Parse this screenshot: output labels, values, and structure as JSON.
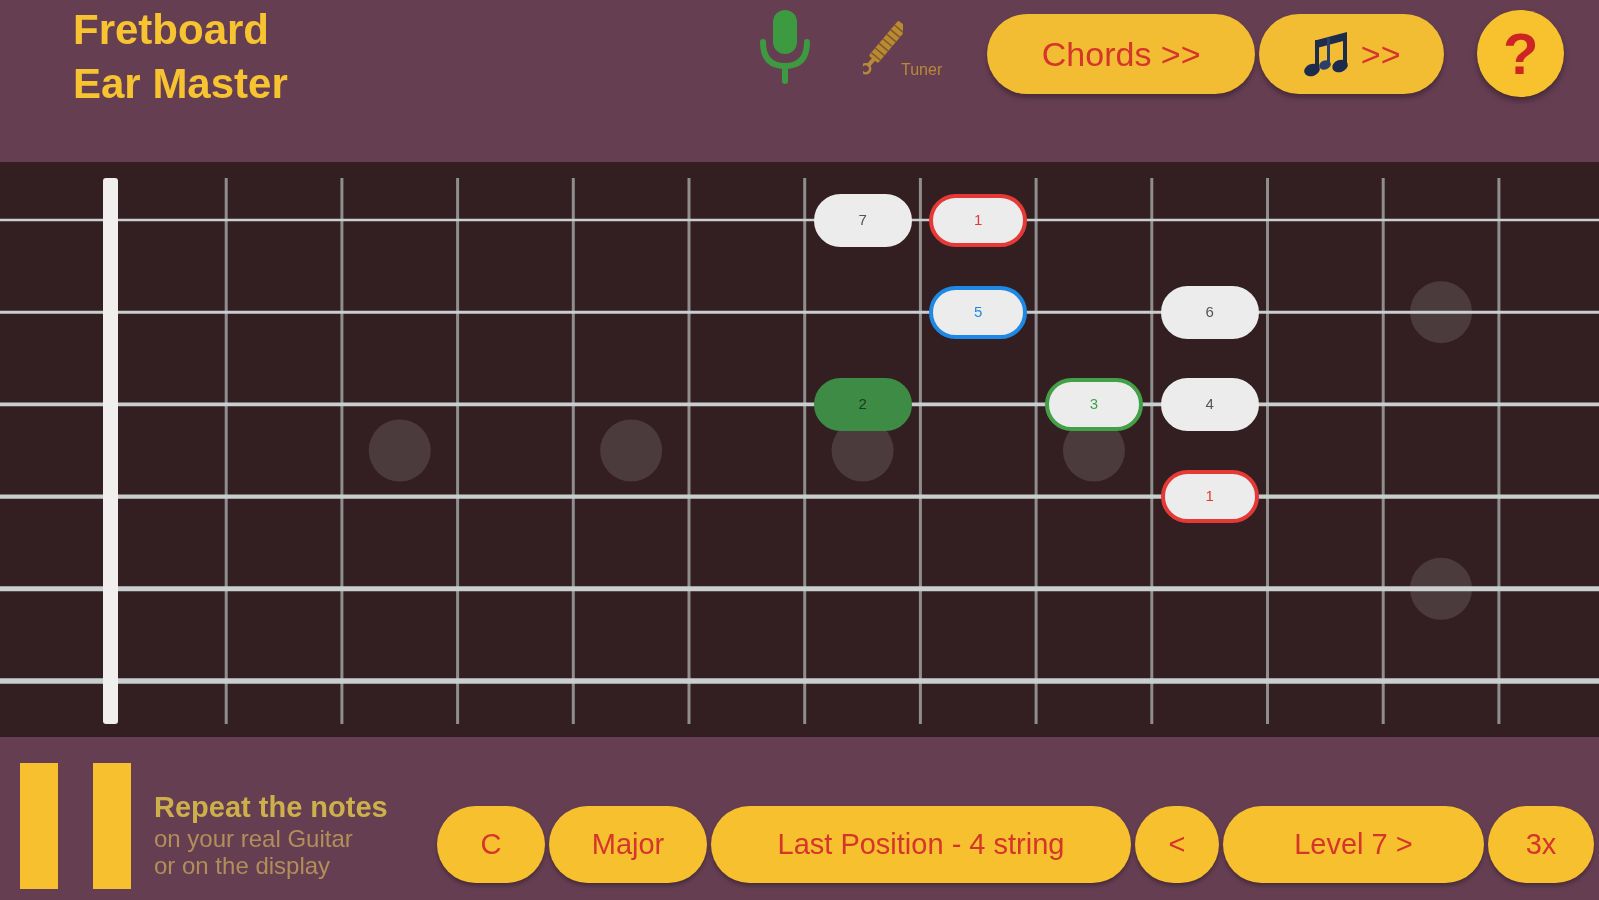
{
  "header": {
    "title": "Fretboard Ear Master",
    "tuner_label": "Tuner",
    "buttons": [
      {
        "label": "Chords >>",
        "kind": "text"
      },
      {
        "label": ">>",
        "kind": "notes"
      }
    ],
    "help": "?"
  },
  "fretboard": {
    "strings": [
      {
        "notes": [
          {
            "label": "7",
            "kind": "plain"
          },
          {
            "label": "1",
            "kind": "outlined",
            "color": "#e53935"
          }
        ]
      },
      {
        "notes": [
          {
            "label": "5",
            "kind": "outlined",
            "color": "#1e88e5"
          },
          {
            "label": "6",
            "kind": "plain"
          }
        ]
      },
      {
        "notes": [
          {
            "label": "2",
            "kind": "filled",
            "color": "#3d8b45"
          },
          {
            "label": "3",
            "kind": "outlined",
            "color": "#43a047"
          },
          {
            "label": "4",
            "kind": "plain"
          }
        ]
      },
      {
        "notes": [
          {
            "label": "1",
            "kind": "outlined",
            "color": "#e53935"
          }
        ]
      }
    ]
  },
  "footer": {
    "prompt": "Repeat the notes",
    "hint": "on your real Guitar or on the display",
    "buttons": [
      {
        "label": "C"
      },
      {
        "label": "Major"
      },
      {
        "label": "Last Position - 4 string"
      },
      {
        "label": "<"
      },
      {
        "label": "Level 7 >"
      },
      {
        "label": "3x"
      }
    ]
  }
}
